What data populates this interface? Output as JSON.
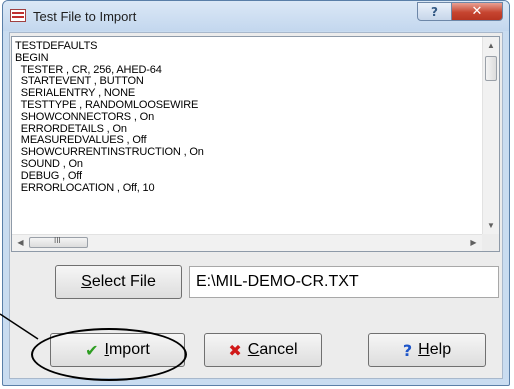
{
  "window": {
    "title": "Test File to Import"
  },
  "file_content": {
    "lines": [
      "TESTDEFAULTS",
      "BEGIN",
      "  TESTER , CR, 256, AHED-64",
      "  STARTEVENT , BUTTON",
      "  SERIALENTRY , NONE",
      "  TESTTYPE , RANDOMLOOSEWIRE",
      "  SHOWCONNECTORS , On",
      "  ERRORDETAILS , On",
      "  MEASUREDVALUES , Off",
      "  SHOWCURRENTINSTRUCTION , On",
      "  SOUND , On",
      "  DEBUG , Off",
      "  ERRORLOCATION , Off, 10"
    ],
    "hscroll_grip": "III"
  },
  "select_file": {
    "label_mnemonic": "S",
    "label_rest": "elect File",
    "path_value": "E:\\MIL-DEMO-CR.TXT"
  },
  "buttons": {
    "import": {
      "mnemonic": "I",
      "rest": "mport",
      "icon": "checkmark-icon",
      "icon_glyph": "✔",
      "icon_color": "#2e9e22"
    },
    "cancel": {
      "mnemonic": "C",
      "rest": "ancel",
      "icon": "x-icon",
      "icon_glyph": "✖",
      "icon_color": "#d01818"
    },
    "help": {
      "mnemonic": "H",
      "rest": "elp",
      "icon": "question-icon",
      "icon_glyph": "?",
      "icon_color": "#1f56c9"
    }
  },
  "titlebar_buttons": {
    "help_glyph": "?",
    "close_glyph": "✕"
  },
  "colors": {
    "window_frame": "#c9dcf0",
    "close_button": "#c64530"
  }
}
